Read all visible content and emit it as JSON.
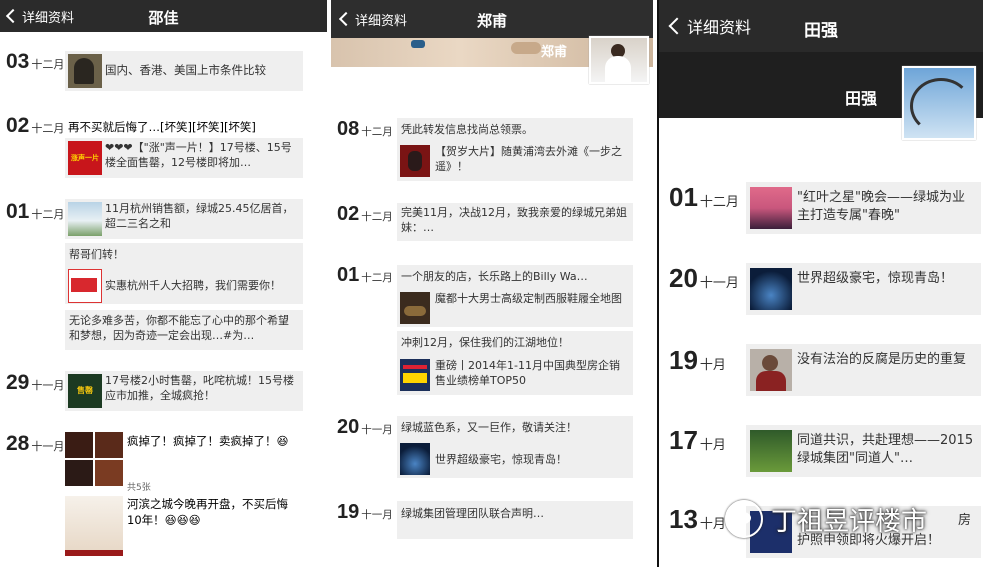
{
  "p1": {
    "back_label": "详细资料",
    "title": "邵佳",
    "posts": [
      {
        "day": "03",
        "month": "十二月",
        "text": "国内、香港、美国上市条件比较"
      },
      {
        "day": "02",
        "month": "十二月",
        "text": "再不买就后悔了…[坏笑][坏笑][坏笑]",
        "sub": "❤❤❤【\"涨\"声一片！】17号楼、15号楼全面售罄，12号楼即将加…",
        "thumb_text": "涨声一片"
      },
      {
        "day": "01",
        "month": "十二月",
        "text": "11月杭州销售额，绿城25.45亿居首，超二三名之和",
        "text2": "帮哥们转！",
        "sub2": "实惠杭州千人大招聘，我们需要你！",
        "text3": "无论多难多苦，你都不能忘了心中的那个希望和梦想，因为奇迹一定会出现…#为…"
      },
      {
        "day": "29",
        "month": "十一月",
        "text": "17号楼2小时售罄，叱咤杭城！15号楼应市加推，全城疯抢！",
        "thumb_text": "售罄"
      },
      {
        "day": "28",
        "month": "十一月",
        "text": "疯掉了！疯掉了！卖疯掉了！😆",
        "count": "共5张",
        "text2": "河滨之城今晚再开盘，不买后悔10年！😆😆😆"
      }
    ]
  },
  "p2": {
    "back_label": "详细资料",
    "title": "郑甫",
    "cover_name": "郑甫",
    "posts": [
      {
        "day": "08",
        "month": "十二月",
        "text": "凭此转发信息找尚总领票。",
        "sub": "【贺岁大片】随黄浦湾去外滩《一步之遥》！"
      },
      {
        "day": "02",
        "month": "十二月",
        "text": "完美11月，决战12月，致我亲爱的绿城兄弟姐妹：…"
      },
      {
        "day": "01",
        "month": "十二月",
        "text": "一个朋友的店，长乐路上的Billy Wa…",
        "sub": "魔都十大男士高级定制西服鞋履全地图",
        "text2": "冲刺12月，保住我们的江湖地位！",
        "sub2": "重磅丨2014年1-11月中国典型房企销售业绩榜单TOP50"
      },
      {
        "day": "20",
        "month": "十一月",
        "text": "绿城蓝色系，又一巨作，敬请关注！",
        "sub": "世界超级豪宅，惊现青岛！"
      },
      {
        "day": "19",
        "month": "十一月",
        "text": "绿城集团管理团队联合声明…"
      }
    ]
  },
  "p3": {
    "back_label": "详细资料",
    "title": "田强",
    "cover_name": "田强",
    "posts": [
      {
        "day": "01",
        "month": "十二月",
        "text": "\"红叶之星\"晚会——绿城为业主打造专属\"春晚\""
      },
      {
        "day": "20",
        "month": "十一月",
        "text": "世界超级豪宅，惊现青岛！"
      },
      {
        "day": "19",
        "month": "十月",
        "text": "没有法治的反腐是历史的重复"
      },
      {
        "day": "17",
        "month": "十月",
        "text": "同道共识，共赴理想——2015绿城集团\"同道人\"…"
      },
      {
        "day": "13",
        "month": "十月",
        "text": "护照申领即将火爆开启！",
        "text_partial": "房"
      }
    ],
    "watermark": "丁祖昱评楼市"
  }
}
